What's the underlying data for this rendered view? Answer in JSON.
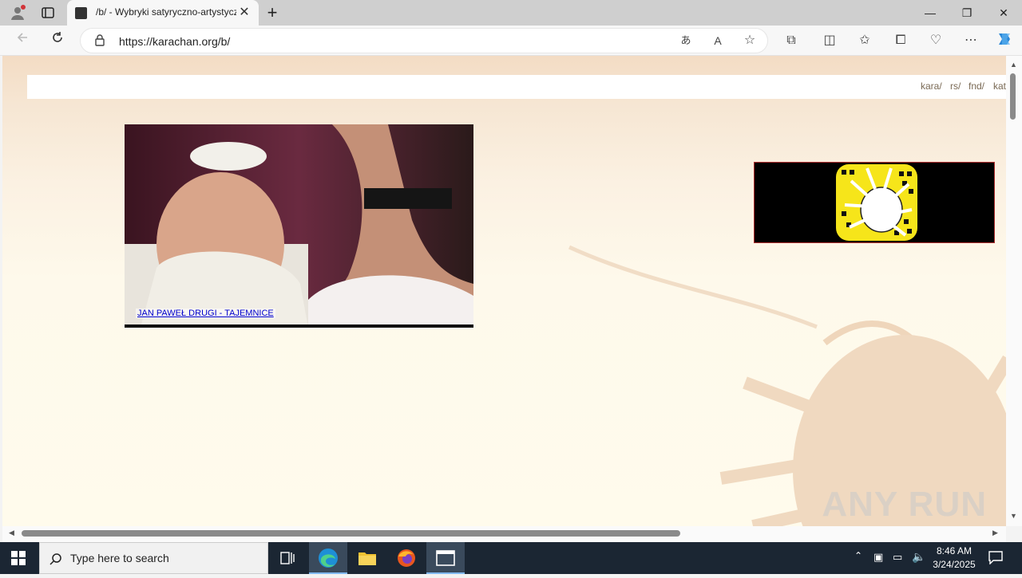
{
  "browser": {
    "tab": {
      "title": "/b/ - Wybryki satyryczno-artystyczne",
      "close_symbol": "✕"
    },
    "new_tab_symbol": "+",
    "window_controls": {
      "minimize": "—",
      "restore": "❐",
      "close": "✕"
    },
    "address": {
      "url": "https://karachan.org/b/"
    },
    "toolbar_icons": [
      "back-icon",
      "refresh-icon",
      "translate-icon",
      "read-aloud-icon",
      "favorite-star-icon",
      "extensions-icon",
      "split-screen-icon",
      "favorites-icon",
      "collections-icon",
      "browser-essentials-icon",
      "more-icon",
      "copilot-icon"
    ]
  },
  "page": {
    "nav_links": [
      "kara/",
      "rs/",
      "fnd/",
      "kat"
    ],
    "banner": {
      "caption": "JAN PAWEŁ DRUGI - TAJEMNICE"
    },
    "ad": {
      "icon": "snapcode-cockroach-icon",
      "accent": "#f6e51a"
    }
  },
  "watermark": "ANY RUN",
  "taskbar": {
    "search_placeholder": "Type here to search",
    "apps": [
      "task-view-icon",
      "edge-icon",
      "file-explorer-icon",
      "firefox-icon",
      "window-app-icon"
    ],
    "time": "8:46 AM",
    "date": "3/24/2025"
  },
  "colors": {
    "page_bg": "#fffbec",
    "link": "#0000cc",
    "taskbar": "#1b2633"
  }
}
